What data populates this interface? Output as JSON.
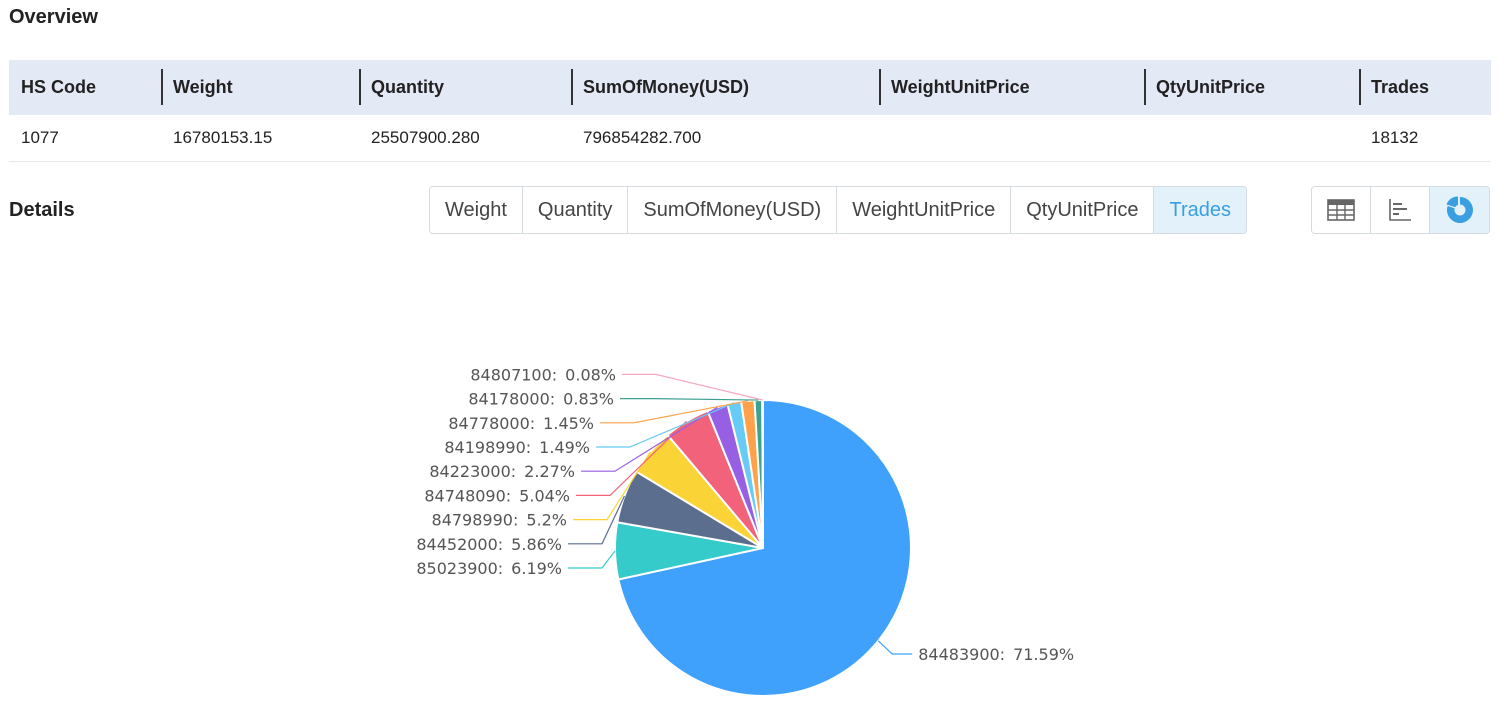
{
  "overview": {
    "title": "Overview",
    "columns": [
      "HS Code",
      "Weight",
      "Quantity",
      "SumOfMoney(USD)",
      "WeightUnitPrice",
      "QtyUnitPrice",
      "Trades"
    ],
    "row": [
      "1077",
      "16780153.15",
      "25507900.280",
      "796854282.700",
      "",
      "",
      "18132"
    ]
  },
  "details": {
    "title": "Details",
    "tabs": [
      "Weight",
      "Quantity",
      "SumOfMoney(USD)",
      "WeightUnitPrice",
      "QtyUnitPrice",
      "Trades"
    ],
    "active_tab": "Trades",
    "view_buttons": [
      {
        "icon": "table-icon",
        "active": false
      },
      {
        "icon": "bar-chart-icon",
        "active": false
      },
      {
        "icon": "pie-chart-icon",
        "active": true
      }
    ]
  },
  "colors": {
    "accent": "#3a9fe0",
    "header_bg": "#e4e9f6",
    "active_tab_bg": "#e3f1fb"
  },
  "chart_data": {
    "type": "pie",
    "separator": ":",
    "slices": [
      {
        "label": "84483900",
        "value": 71.59,
        "text": "71.59%",
        "color": "#3fa1fb"
      },
      {
        "label": "85023900",
        "value": 6.19,
        "text": "6.19%",
        "color": "#36cbcb"
      },
      {
        "label": "84452000",
        "value": 5.86,
        "text": "5.86%",
        "color": "#5b6e8d"
      },
      {
        "label": "84798990",
        "value": 5.2,
        "text": "5.2%",
        "color": "#fad337"
      },
      {
        "label": "84748090",
        "value": 5.04,
        "text": "5.04%",
        "color": "#f2637b"
      },
      {
        "label": "84223000",
        "value": 2.27,
        "text": "2.27%",
        "color": "#975fe4"
      },
      {
        "label": "84198990",
        "value": 1.49,
        "text": "1.49%",
        "color": "#66cbf5"
      },
      {
        "label": "84778000",
        "value": 1.45,
        "text": "1.45%",
        "color": "#fda24b"
      },
      {
        "label": "84178000",
        "value": 0.83,
        "text": "0.83%",
        "color": "#3da18f"
      },
      {
        "label": "84807100",
        "value": 0.08,
        "text": "0.08%",
        "color": "#f7a8c0"
      }
    ]
  }
}
